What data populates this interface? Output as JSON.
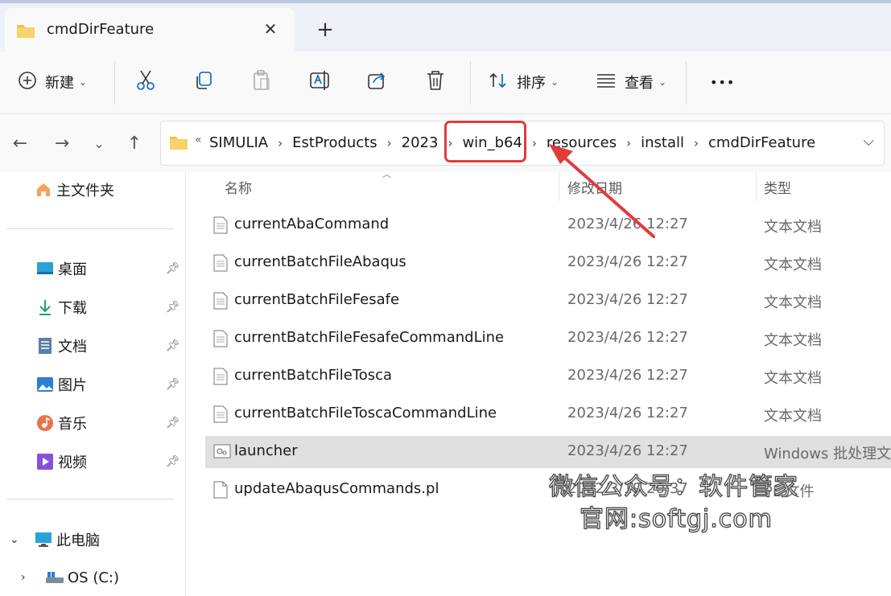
{
  "window": {
    "tab_title": "cmdDirFeature",
    "close_glyph": "✕",
    "new_tab_glyph": "+"
  },
  "toolbar": {
    "new_label": "新建",
    "sort_label": "排序",
    "view_label": "查看",
    "more_label": "•••"
  },
  "address": {
    "overflow": "«",
    "crumbs": [
      "SIMULIA",
      "EstProducts",
      "2023",
      "win_b64",
      "resources",
      "install",
      "cmdDirFeature"
    ],
    "sep": "›",
    "dropdown": "⌵"
  },
  "sidebar": {
    "home": "主文件夹",
    "quick": [
      {
        "label": "桌面",
        "icon": "desktop-icon"
      },
      {
        "label": "下载",
        "icon": "download-icon"
      },
      {
        "label": "文档",
        "icon": "document-icon"
      },
      {
        "label": "图片",
        "icon": "pictures-icon"
      },
      {
        "label": "音乐",
        "icon": "music-icon"
      },
      {
        "label": "视频",
        "icon": "video-icon"
      }
    ],
    "this_pc": "此电脑",
    "os_drive": "OS (C:)"
  },
  "columns": {
    "name": "名称",
    "date": "修改日期",
    "type": "类型"
  },
  "files": [
    {
      "name": "currentAbaCommand",
      "date": "2023/4/26 12:27",
      "type": "文本文档"
    },
    {
      "name": "currentBatchFileAbaqus",
      "date": "2023/4/26 12:27",
      "type": "文本文档"
    },
    {
      "name": "currentBatchFileFesafe",
      "date": "2023/4/26 12:27",
      "type": "文本文档"
    },
    {
      "name": "currentBatchFileFesafeCommandLine",
      "date": "2023/4/26 12:27",
      "type": "文本文档"
    },
    {
      "name": "currentBatchFileTosca",
      "date": "2023/4/26 12:27",
      "type": "文本文档"
    },
    {
      "name": "currentBatchFileToscaCommandLine",
      "date": "2023/4/26 12:27",
      "type": "文本文档"
    },
    {
      "name": "launcher",
      "date": "2023/4/26 12:27",
      "type": "Windows 批处理文件"
    },
    {
      "name": "updateAbaqusCommands.pl",
      "date": "2022/3/19 20:37",
      "type": "PL 文件"
    }
  ],
  "watermark": {
    "line1": "微信公众号：软件管家",
    "line2": "官网:softgj.com"
  },
  "colors": {
    "highlight": "#e03c3c",
    "accent": "#0067c0",
    "folder": "#f3c14a"
  }
}
